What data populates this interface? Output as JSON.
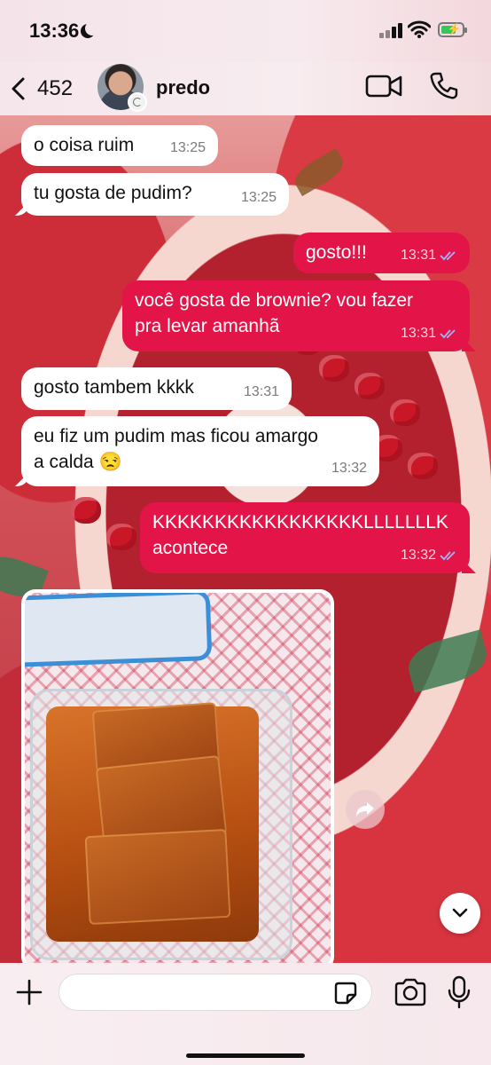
{
  "status_bar": {
    "time": "13:36"
  },
  "header": {
    "back_count": "452",
    "contact_name": "predo"
  },
  "messages": [
    {
      "text": "o coisa ruim",
      "time": "13:25"
    },
    {
      "text": "tu gosta de pudim?",
      "time": "13:25"
    },
    {
      "text": "gosto!!!",
      "time": "13:31"
    },
    {
      "text_line1": "você gosta de brownie? vou fazer",
      "text_line2": "pra levar amanhã",
      "time": "13:31"
    },
    {
      "text": "gosto tambem kkkk",
      "time": "13:31"
    },
    {
      "text_line1": "eu fiz um pudim mas ficou amargo",
      "text_line2": "a calda 😒",
      "time": "13:32"
    },
    {
      "text_line1": "KKKKKKKKKKKKKKKKKLLLLLLLK",
      "text_line2": "acontece",
      "time": "13:32"
    }
  ],
  "input": {
    "placeholder": ""
  },
  "colors": {
    "outgoing_bubble": "#e31548",
    "incoming_bubble": "#ffffff",
    "read_ticks": "#9fb5ff"
  },
  "icons": [
    "back-chevron-icon",
    "video-call-icon",
    "phone-icon",
    "share-icon",
    "chevron-down-icon",
    "plus-icon",
    "sticker-icon",
    "camera-icon",
    "microphone-icon"
  ]
}
